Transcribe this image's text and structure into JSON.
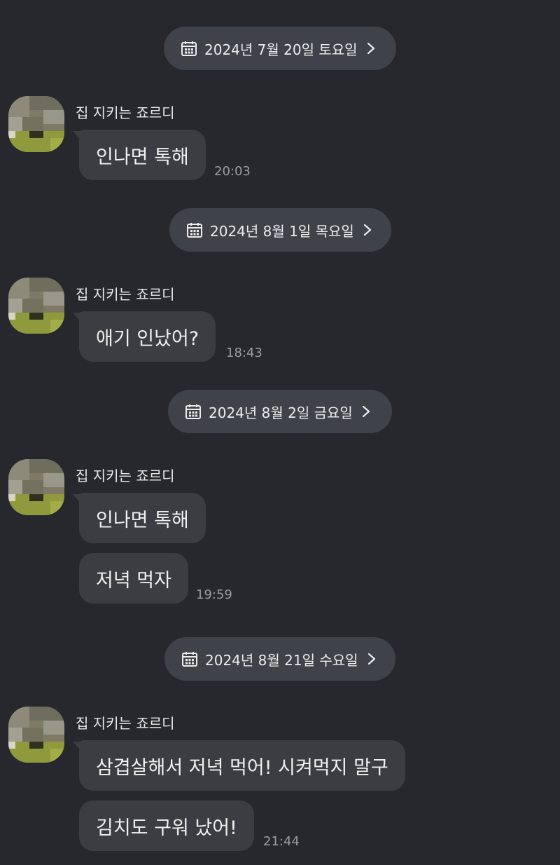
{
  "sender_name": "집 지키는 죠르디",
  "date_separators": [
    {
      "label": "2024년 7월 20일 토요일",
      "icon": "calendar-icon"
    },
    {
      "label": "2024년 8월 1일 목요일",
      "icon": "calendar-icon"
    },
    {
      "label": "2024년 8월 2일 금요일",
      "icon": "calendar-icon"
    },
    {
      "label": "2024년 8월 21일 수요일",
      "icon": "calendar-icon"
    }
  ],
  "groups": [
    {
      "sender": "집 지키는 죠르디",
      "messages": [
        "인나면 톡해"
      ],
      "time": "20:03"
    },
    {
      "sender": "집 지키는 죠르디",
      "messages": [
        "애기 인났어?"
      ],
      "time": "18:43"
    },
    {
      "sender": "집 지키는 죠르디",
      "messages": [
        "인나면 톡해",
        "저녁 먹자"
      ],
      "time": "19:59"
    },
    {
      "sender": "집 지키는 죠르디",
      "messages": [
        "삼겹살해서 저녁 먹어! 시켜먹지 말구",
        "김치도 구워 났어!"
      ],
      "time": "21:44"
    }
  ],
  "colors": {
    "background": "#26282e",
    "bubble": "#3b3d43",
    "date_pill": "#3f4248",
    "time_text": "#9a9ca2"
  }
}
